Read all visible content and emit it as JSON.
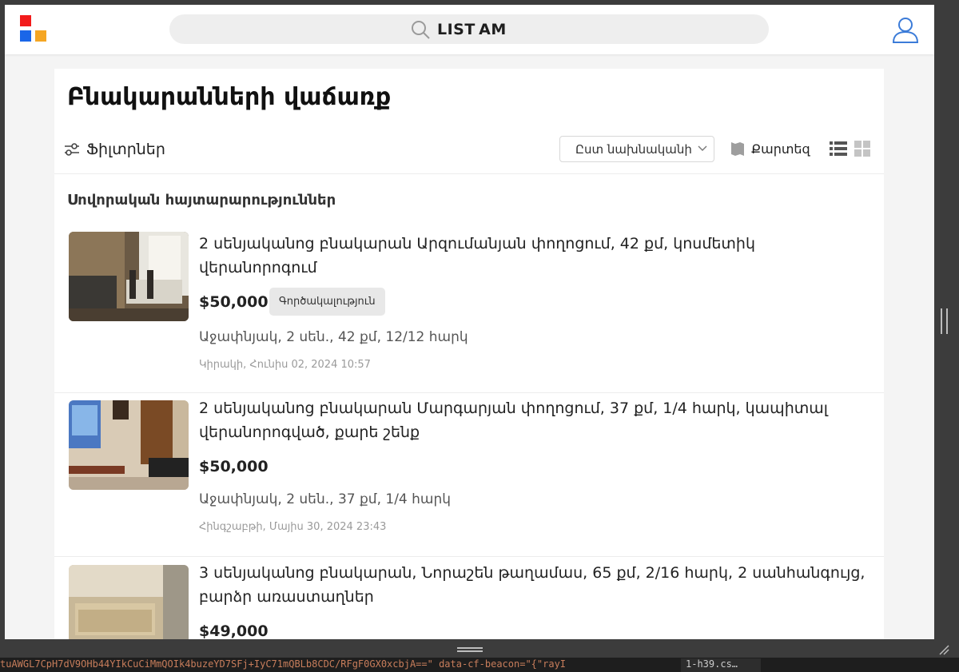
{
  "header": {
    "brand": "LIST AM",
    "brand_accent": "#f21b1b",
    "logo_colors": [
      "#f21b1b",
      "#1a66e8",
      "#f5a623"
    ],
    "user_icon_color": "#3b7bd8"
  },
  "page": {
    "title": "Բնակարանների վաճառք",
    "filters_label": "Ֆիլտրներ",
    "sort_label": "Ըստ նախնականի",
    "map_label": "Քարտեզ",
    "section_title": "Սովորական հայտարարություններ"
  },
  "listings": [
    {
      "title": "2 սենյականոց բնակարան Արզումանյան փողոցում, 42 քմ, կոսմետիկ վերանորոգում",
      "price": "$50,000",
      "badge": "Գործակալություն",
      "meta": "Աջափնյակ, 2 սեն., 42 քմ, 12/12 հարկ",
      "date": "Կիրակի, Հունիս 02, 2024 10:57"
    },
    {
      "title": "2 սենյականոց բնակարան Մարգարյան փողոցում, 37 քմ, 1/4 հարկ, կապիտալ վերանորոգված, քարե շենք",
      "price": "$50,000",
      "meta": "Աջափնյակ, 2 սեն., 37 քմ, 1/4 հարկ",
      "date": "Հինգշաբթի, Մայիս 30, 2024 23:43"
    },
    {
      "title": "3 սենյականոց բնակարան, Նորաշեն թաղամաս, 65 քմ, 2/16 հարկ, 2 սանհանգույց, բարձր առաստաղներ",
      "price": "$49,000"
    }
  ],
  "devtools": {
    "code_snippet": "tuAWGL7CpH7dV9OHb44YIkCuCiMmQOIk4buzeYD7SFj+IyC71mQBLb8CDC/RFgF0GX0xcbjA==\" data-cf-beacon=\"{\"rayI",
    "file_tab": "1-h39.cs…"
  }
}
